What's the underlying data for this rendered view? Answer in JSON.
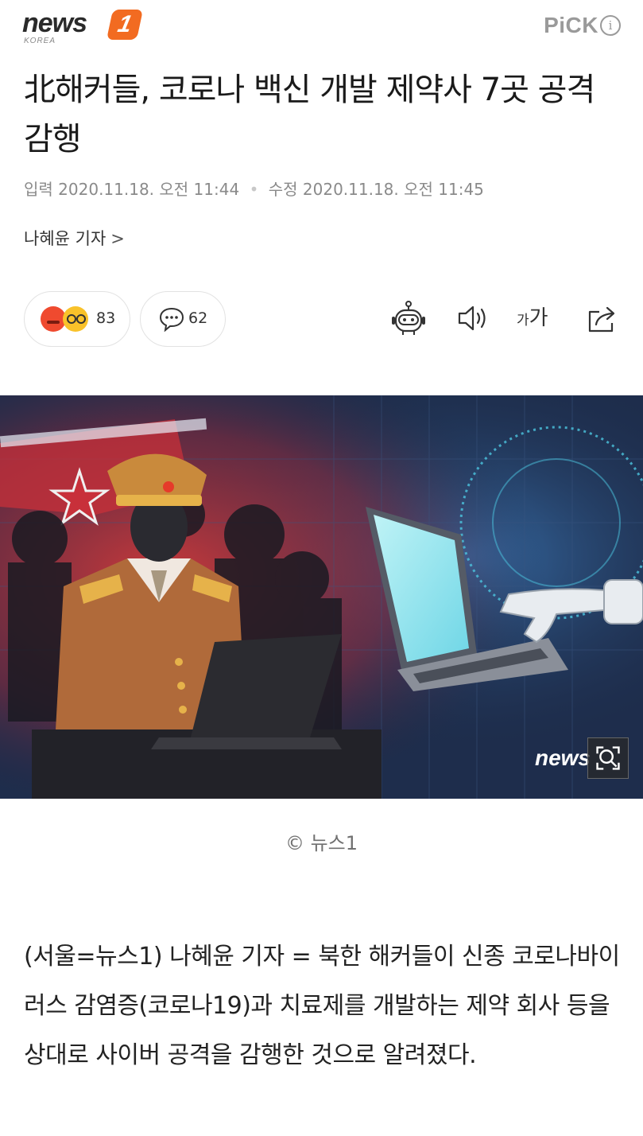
{
  "header": {
    "logo_text": "news",
    "logo_badge": "1",
    "logo_sub": "KOREA",
    "pick_label": "PiCK",
    "info_label": "i"
  },
  "article": {
    "headline": "北해커들, 코로나 백신 개발 제약사 7곳 공격 감행",
    "input_label": "입력",
    "input_date": "2020.11.18. 오전 11:44",
    "modified_label": "수정",
    "modified_date": "2020.11.18. 오전 11:45",
    "separator": "•",
    "reporter": "나혜윤 기자",
    "reporter_chevron": ">"
  },
  "reactions": {
    "reaction_count": "83",
    "comment_count": "62",
    "font_small": "가",
    "font_large": "가"
  },
  "photo": {
    "watermark": "news",
    "caption": "© 뉴스1"
  },
  "body": {
    "paragraph": "(서울=뉴스1) 나혜윤 기자 = 북한 해커들이 신종 코로나바이러스 감염증(코로나19)과 치료제를 개발하는 제약 회사 등을 상대로 사이버 공격을 감행한 것으로 알려졌다."
  },
  "icons": {
    "angry": "angry-emoji-icon",
    "dizzy": "dizzy-emoji-icon",
    "comment": "speech-bubble-icon",
    "robot": "robot-tts-icon",
    "sound": "speaker-icon",
    "share": "share-icon",
    "zoom": "zoom-icon"
  },
  "colors": {
    "brand": "#f26b21",
    "muted": "#8a8a8a"
  }
}
